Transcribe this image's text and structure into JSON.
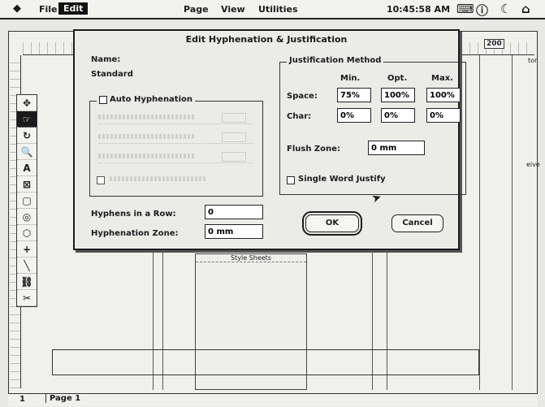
{
  "menubar": {
    "apple": "◆",
    "items": [
      "File",
      "Edit",
      "Page",
      "View",
      "Utilities"
    ],
    "clock": "10:45:58 AM"
  },
  "dialog": {
    "title": "Edit Hyphenation & Justification",
    "name_label": "Name:",
    "name_value": "Standard",
    "auto_hyphenation": {
      "label": "Auto Hyphenation",
      "checked": false
    },
    "hyphens_in_row": {
      "label": "Hyphens in a Row:",
      "value": "0"
    },
    "hyphenation_zone": {
      "label": "Hyphenation Zone:",
      "value": "0 mm"
    },
    "justification": {
      "title": "Justification Method",
      "headers": [
        "Min.",
        "Opt.",
        "Max."
      ],
      "space": {
        "label": "Space:",
        "min": "75%",
        "opt": "100%",
        "max": "100%"
      },
      "char": {
        "label": "Char:",
        "min": "0%",
        "opt": "0%",
        "max": "0%"
      },
      "flush_zone": {
        "label": "Flush Zone:",
        "value": "0 mm"
      },
      "single_word": {
        "label": "Single Word Justify",
        "checked": false
      }
    },
    "ok": "OK",
    "cancel": "Cancel"
  },
  "document": {
    "ruler_value": "200",
    "stylesheet_title": "Style Sheets",
    "status": {
      "zoom": "1",
      "page": "Page 1"
    },
    "right_peek": [
      "tor",
      "eive"
    ]
  }
}
